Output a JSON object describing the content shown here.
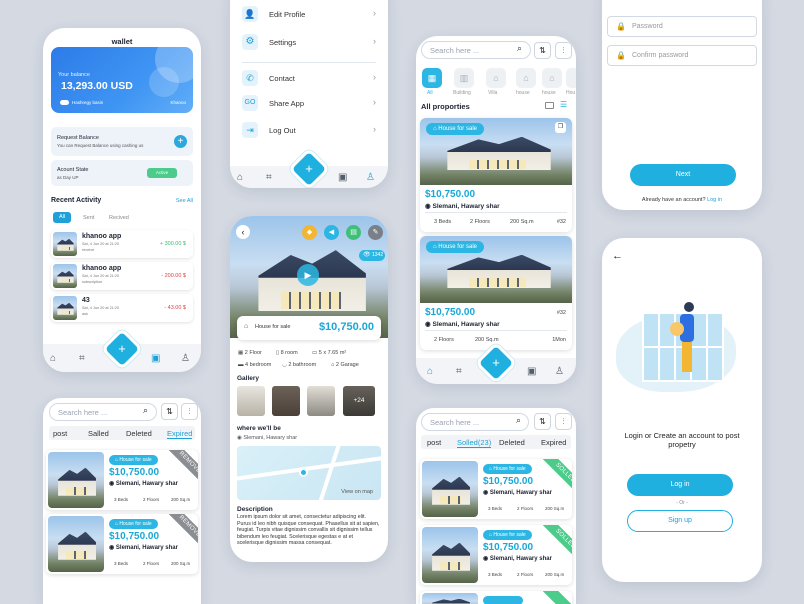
{
  "wallet": {
    "title": "wallet",
    "balance_label": "Your balance",
    "balance": "13,293.00 USD",
    "account_name": "Hashregy basin",
    "account_side": "Khanoo",
    "request_title": "Request Balance",
    "request_sub": "You can Request Balance using  cashing us",
    "state_title": "Acount State",
    "state_date": "as Day UP",
    "state_badge": "Active",
    "activity_title": "Recent Activity",
    "see_all": "See All",
    "tabs": [
      "All",
      "Sent",
      "Recived"
    ],
    "items": [
      {
        "name": "khanoo app",
        "date": "Sat, 4 Jun 20 at 21:20",
        "kind": "receive",
        "amount": "+ 300.00 $"
      },
      {
        "name": "khanoo app",
        "date": "Sat, 4 Jun 20 at 21:20",
        "kind": "subscription",
        "amount": "- 200.00 $"
      },
      {
        "name": "43",
        "date": "Sat, 4 Jun 20 at 21:20",
        "kind": "ask",
        "amount": "- 43.00 $"
      }
    ]
  },
  "settings": {
    "items": [
      "Edit Profile",
      "Settings",
      "Contact",
      "Share App",
      "Log Out"
    ]
  },
  "detail": {
    "views": "1342",
    "tag": "House for sale",
    "price": "$10,750.00",
    "feat_row1": [
      "2 Floor",
      "8 room",
      "5 x 7.65 m²"
    ],
    "feat_row2": [
      "4 bedroom",
      "2 bathroom",
      "2 Garage"
    ],
    "gallery_title": "Gallery",
    "gallery_more": "+24",
    "where_title": "where we'll be",
    "where_location": "Slemani, Hawary shar",
    "map_label": "View on map",
    "desc_title": "Description",
    "desc_text": "Lorem ipsum dolor sit amet, consectetur adipiscing elit. Purus id leo nibh quisque consequat. Phasellus sit at sapien, feugiat. Turpis vitae dignissim convallis sit dignissim tellus bibendum leo feugiat. Scelerisque egestas e at et scelerisque dignissim massa consequat."
  },
  "listing": {
    "search_placeholder": "Search here ...",
    "categories": [
      "All",
      "Building",
      "Villa",
      "house",
      "house",
      "Hou"
    ],
    "all_properties": "All proporties",
    "cards": [
      {
        "tag": "House for sale",
        "price": "$10,750.00",
        "location": "Slemani, Hawary shar",
        "features": [
          "3 Beds",
          "2 Floors",
          "200 Sq.m"
        ],
        "id": "#32"
      },
      {
        "tag": "House for sale",
        "price": "$10,750.00",
        "location": "Slemani, Hawary shar",
        "features": [
          "2 Floors",
          "200 Sq.m"
        ],
        "id": "#32",
        "extra": "1Mon"
      }
    ]
  },
  "register": {
    "password_placeholder": "Password",
    "confirm_placeholder": "Confirm password",
    "next": "Next",
    "already": "Already have an account?",
    "login_link": "Log in"
  },
  "myposts_left": {
    "search_placeholder": "Search here ...",
    "tabs": [
      "post",
      "Salled",
      "Deleted",
      "Expired"
    ],
    "cards": [
      {
        "tag": "House for sale",
        "price": "$10,750.00",
        "location": "Slemani, Hawary shar",
        "features": [
          "3 Beds",
          "2 Floors",
          "200 Sq.m"
        ],
        "ribbon": "REMOVED"
      },
      {
        "tag": "House for sale",
        "price": "$10,750.00",
        "location": "Slemani, Hawary shar",
        "features": [
          "3 Beds",
          "2 Floors",
          "200 Sq.m"
        ],
        "ribbon": "REMOVED"
      }
    ]
  },
  "myposts_mid": {
    "search_placeholder": "Search here ...",
    "tabs": [
      "post",
      "Solled(23)",
      "Deleted",
      "Expired"
    ],
    "cards": [
      {
        "tag": "House for sale",
        "price": "$10,750.00",
        "location": "Slemani, Hawary shar",
        "features": [
          "3 Beds",
          "2 Floors",
          "200 Sq.m"
        ],
        "ribbon": "SOLLED"
      },
      {
        "tag": "House for sale",
        "price": "$10,750.00",
        "location": "Slemani, Hawary shar",
        "features": [
          "3 Beds",
          "2 Floors",
          "200 Sq.m"
        ],
        "ribbon": "SOLLED"
      }
    ]
  },
  "welcome": {
    "text": "Login or Create an account to post propetry",
    "login": "Log in",
    "or": "- Or -",
    "signup": "Sign up"
  },
  "colors": {
    "accent": "#1fb0e0",
    "green": "#4ccb8a",
    "red": "#e0413b"
  }
}
